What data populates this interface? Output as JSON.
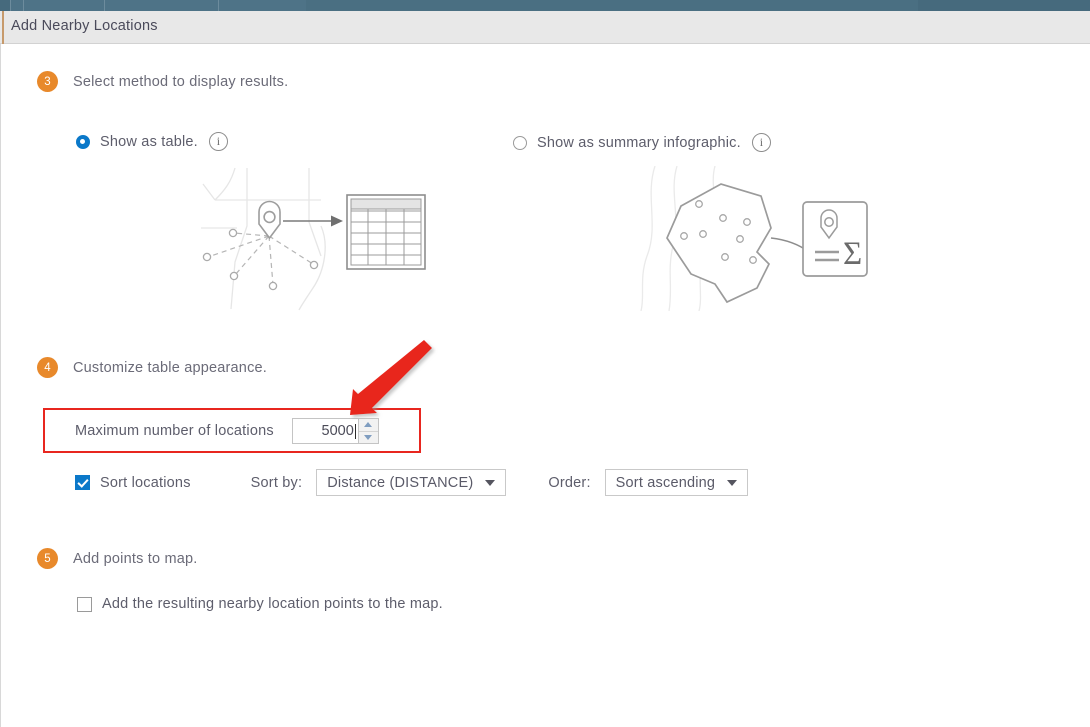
{
  "window": {
    "title": "Add Nearby Locations",
    "chrome_color": "#4e7387",
    "header_bg": "#e8e8e8"
  },
  "theme": {
    "badge_orange": "#e8892b",
    "accent_blue": "#0b78c9",
    "annotation_red": "#e8261f",
    "text_gray": "#5d5d6b"
  },
  "steps": [
    {
      "number": "3",
      "label": "Select method to display results."
    },
    {
      "number": "4",
      "label": "Customize table appearance."
    },
    {
      "number": "5",
      "label": "Add points to map."
    }
  ],
  "display_method": {
    "options": [
      {
        "label": "Show as table.",
        "selected": true,
        "info_icon": "info-icon",
        "info_glyph": "i"
      },
      {
        "label": "Show as summary infographic.",
        "selected": false,
        "info_icon": "info-icon",
        "info_glyph": "i"
      }
    ]
  },
  "illustrations": {
    "table_option": "map-pin-to-table-illustration",
    "infographic_option": "polygon-to-summary-card-illustration",
    "sigma_glyph": "Σ"
  },
  "customize_table": {
    "max_locations_label": "Maximum number of locations",
    "max_locations_value": "5000",
    "spinner_up_icon": "spinner-up-arrow-icon",
    "spinner_down_icon": "spinner-down-arrow-icon",
    "sort_locations_label": "Sort locations",
    "sort_locations_checked": true,
    "sort_by_label": "Sort by:",
    "sort_by_value": "Distance (DISTANCE)",
    "order_label": "Order:",
    "order_value": "Sort ascending",
    "caret_icon": "chevron-down-icon"
  },
  "add_points": {
    "checkbox_label": "Add the resulting nearby location points to the map.",
    "checked": false
  },
  "annotation": {
    "arrow": "red-arrow-pointing-to-max-locations-field",
    "highlight": "red-rectangle-around-max-locations-row"
  }
}
